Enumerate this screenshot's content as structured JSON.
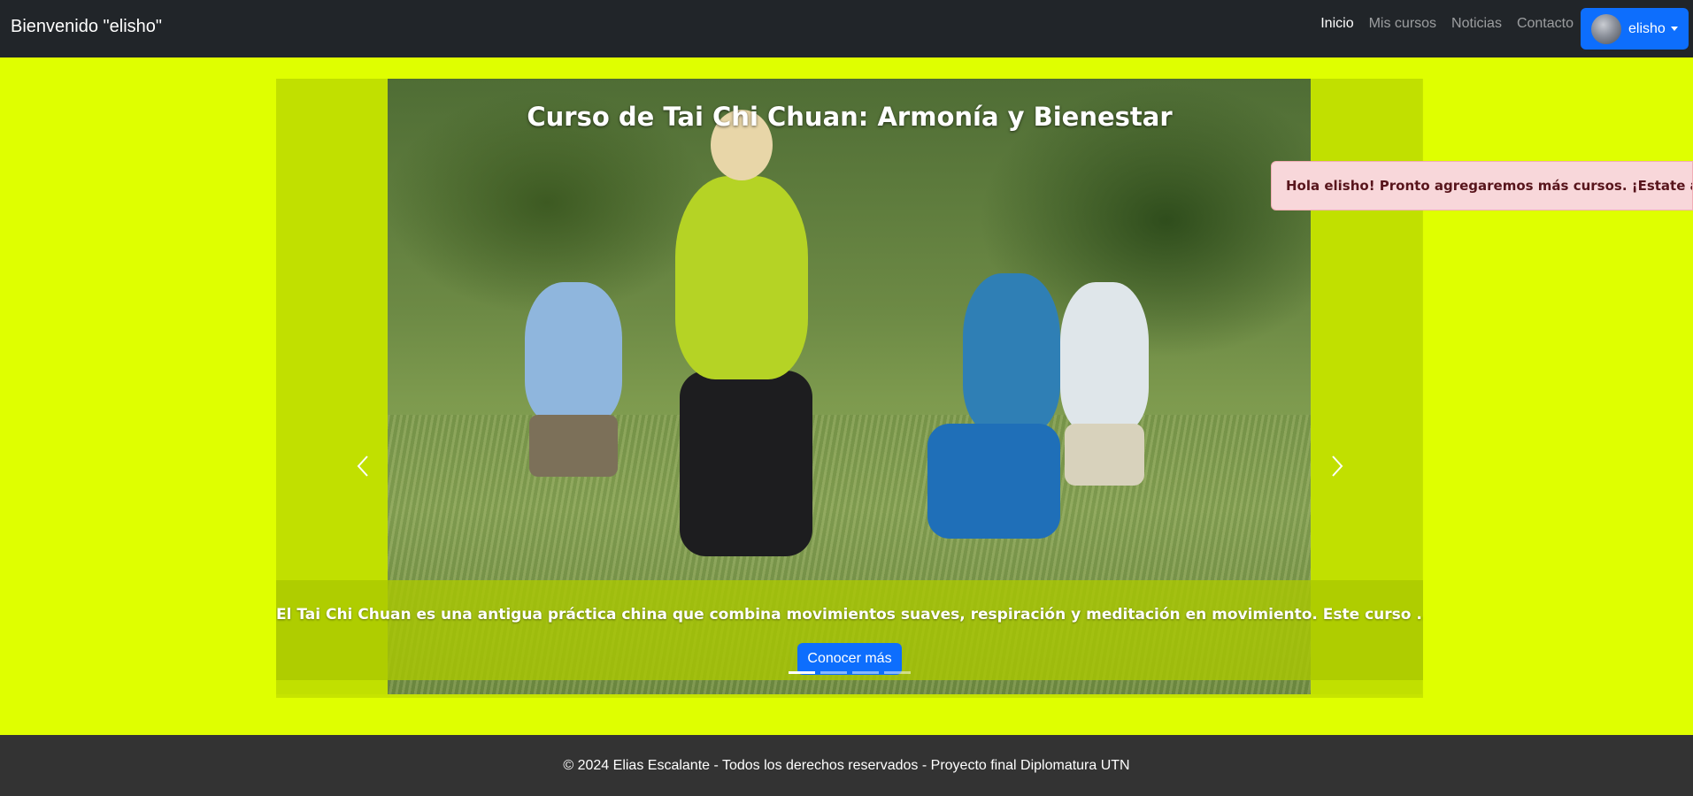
{
  "header": {
    "brand": "Bienvenido \"elisho\"",
    "nav": [
      {
        "label": "Inicio",
        "active": true
      },
      {
        "label": "Mis cursos",
        "active": false
      },
      {
        "label": "Noticias",
        "active": false
      },
      {
        "label": "Contacto",
        "active": false
      }
    ],
    "user": {
      "name": "elisho"
    }
  },
  "carousel": {
    "title": "Curso de Tai Chi Chuan: Armonía y Bienestar",
    "caption": "El Tai Chi Chuan es una antigua práctica china que combina movimientos suaves, respiración y meditación en movimiento. Este curso ...",
    "button_label": "Conocer más",
    "slide_count": 4,
    "active_slide": 1
  },
  "toast": {
    "message": "Hola elisho! Pronto agregaremos más cursos. ¡Estate atento!"
  },
  "footer": {
    "text": "© 2024 Elias Escalante - Todos los derechos reservados - Proyecto final Diplomatura UTN"
  },
  "colors": {
    "navbar_bg": "#212529",
    "page_bg": "#dfff00",
    "primary": "#0d6efd",
    "toast_bg": "#f8d7da",
    "toast_text": "#58151c",
    "footer_bg": "#333333"
  }
}
